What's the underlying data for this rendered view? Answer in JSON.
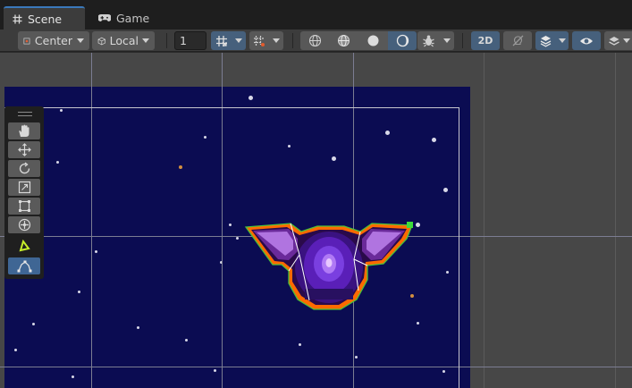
{
  "tabs": [
    {
      "label": "Scene",
      "icon": "hash-icon",
      "active": true
    },
    {
      "label": "Game",
      "icon": "gamepad-icon",
      "active": false
    }
  ],
  "toolbar": {
    "pivot_mode": "Center",
    "pivot_rotation": "Local",
    "grid_size": "1",
    "view_2d_label": "2D"
  },
  "tools": [
    "view-tool",
    "move-tool",
    "rotate-tool",
    "scale-tool",
    "rect-tool",
    "transform-tool",
    "custom-editor-tool",
    "collider-edit-tool"
  ],
  "colors": {
    "camera_background": "#0b0c52",
    "selection_outline": "#ff6a00",
    "collider": "#4cc13a",
    "active_blue": "#46607c"
  }
}
